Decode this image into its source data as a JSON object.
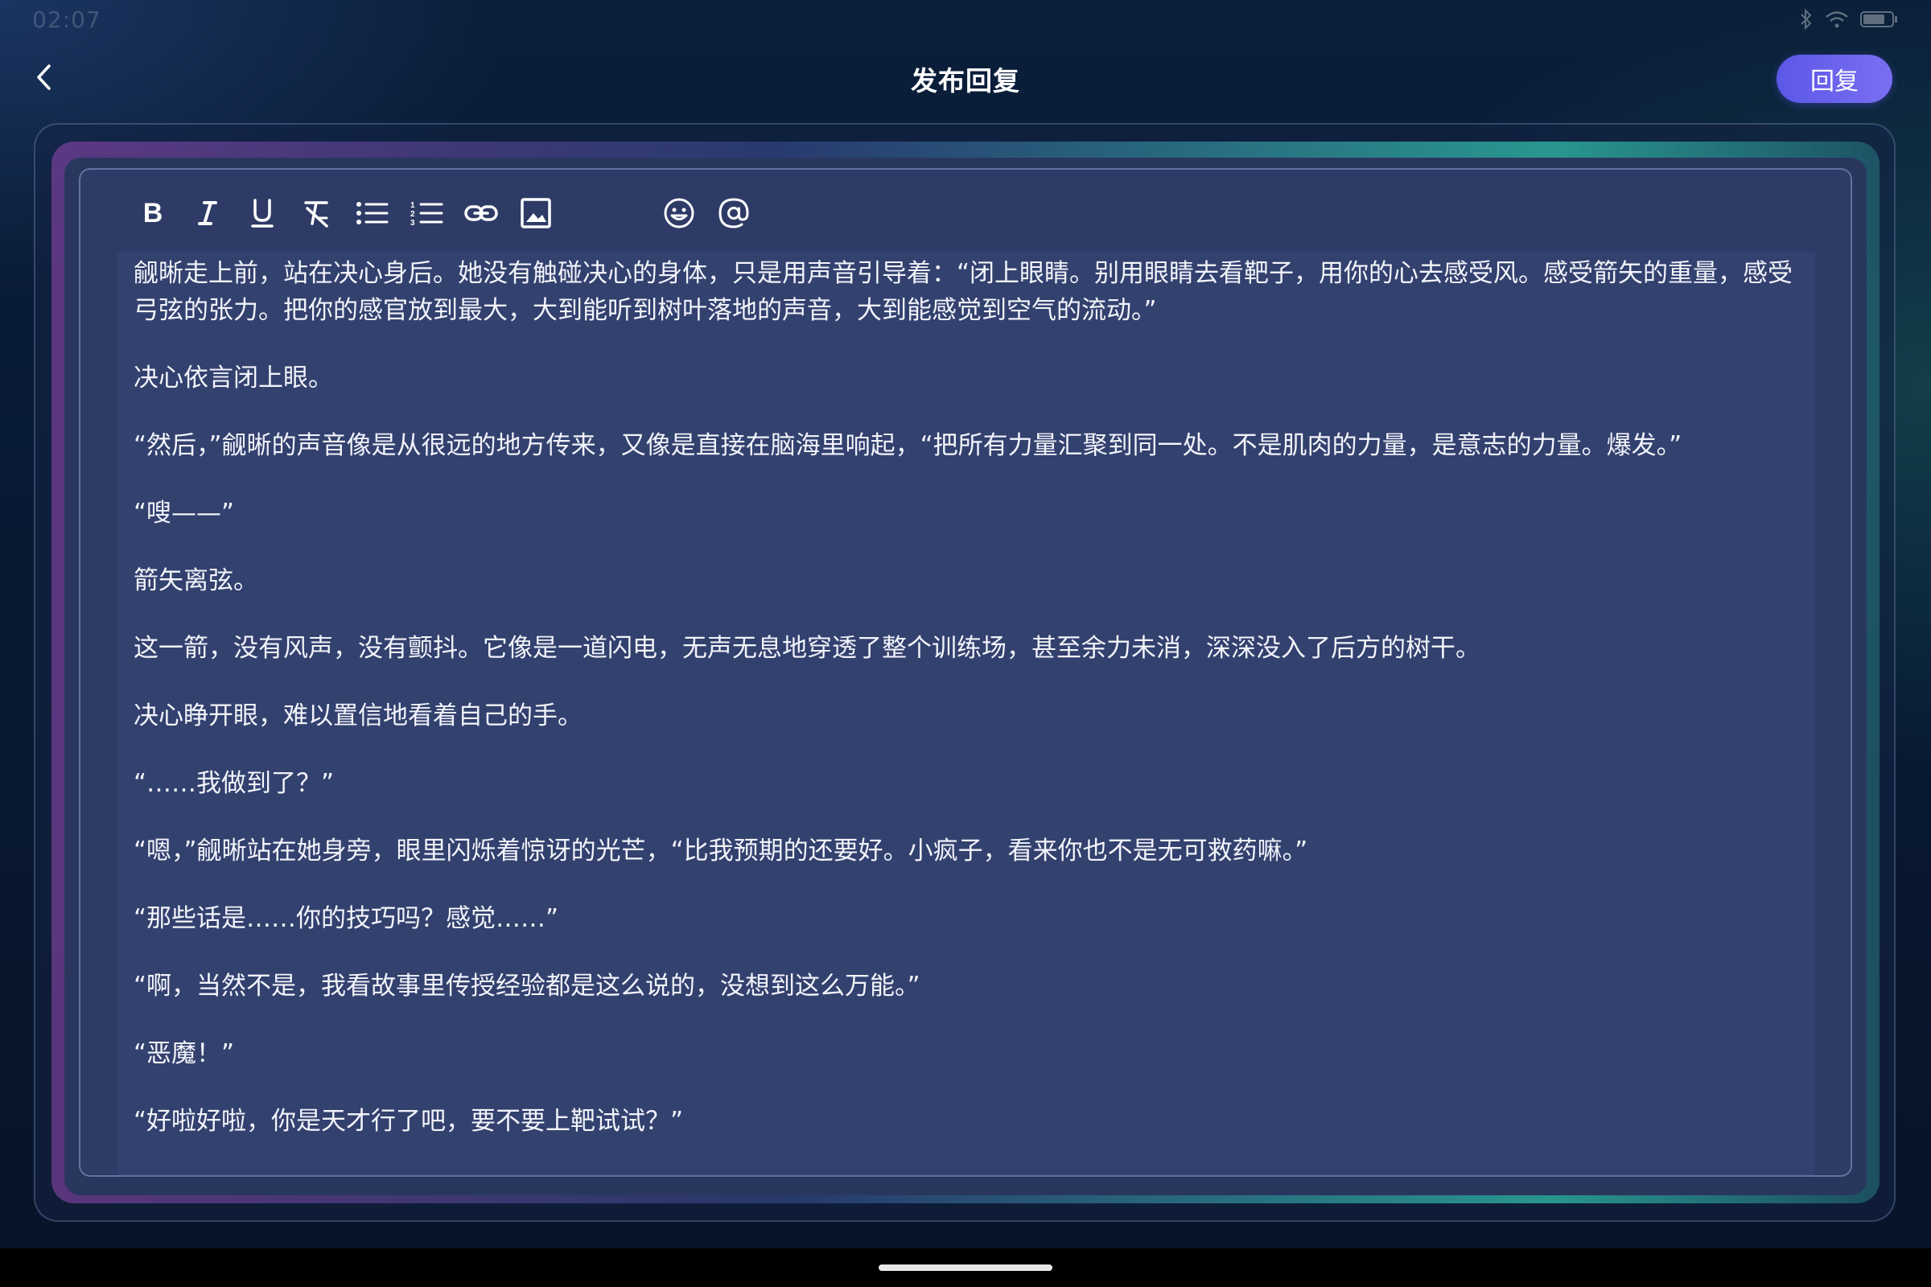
{
  "status_bar": {
    "time": "02:07"
  },
  "header": {
    "back_icon": "chevron-left-icon",
    "title": "发布回复",
    "reply_label": "回复"
  },
  "toolbar": {
    "tools": [
      {
        "name": "bold-icon",
        "glyph": "B"
      },
      {
        "name": "italic-icon",
        "glyph": "I"
      },
      {
        "name": "underline-icon",
        "glyph": "U"
      },
      {
        "name": "clear-format-icon"
      },
      {
        "name": "bullet-list-icon"
      },
      {
        "name": "numbered-list-icon"
      },
      {
        "name": "link-icon"
      },
      {
        "name": "image-icon"
      },
      {
        "name": "emoji-icon"
      },
      {
        "name": "mention-icon"
      }
    ]
  },
  "editor": {
    "paragraphs": [
      "觎晰走上前，站在决心身后。她没有触碰决心的身体，只是用声音引导着：“闭上眼睛。别用眼睛去看靶子，用你的心去感受风。感受箭矢的重量，感受弓弦的张力。把你的感官放到最大，大到能听到树叶落地的声音，大到能感觉到空气的流动。”",
      "决心依言闭上眼。",
      "“然后，”觎晰的声音像是从很远的地方传来，又像是直接在脑海里响起，“把所有力量汇聚到同一处。不是肌肉的力量，是意志的力量。爆发。”",
      "“嗖——”",
      "箭矢离弦。",
      "这一箭，没有风声，没有颤抖。它像是一道闪电，无声无息地穿透了整个训练场，甚至余力未消，深深没入了后方的树干。",
      "决心睁开眼，难以置信地看着自己的手。",
      "“……我做到了？”",
      "“嗯，”觎晰站在她身旁，眼里闪烁着惊讶的光芒，“比我预期的还要好。小疯子，看来你也不是无可救药嘛。”",
      "“那些话是……你的技巧吗？感觉……”",
      "“啊，当然不是，我看故事里传授经验都是这么说的，没想到这么万能。”",
      "“恶魔！”",
      "“好啦好啦，你是天才行了吧，要不要上靶试试？”"
    ]
  },
  "colors": {
    "accent": "#5b57e8",
    "editor_bg": "#33416f"
  }
}
